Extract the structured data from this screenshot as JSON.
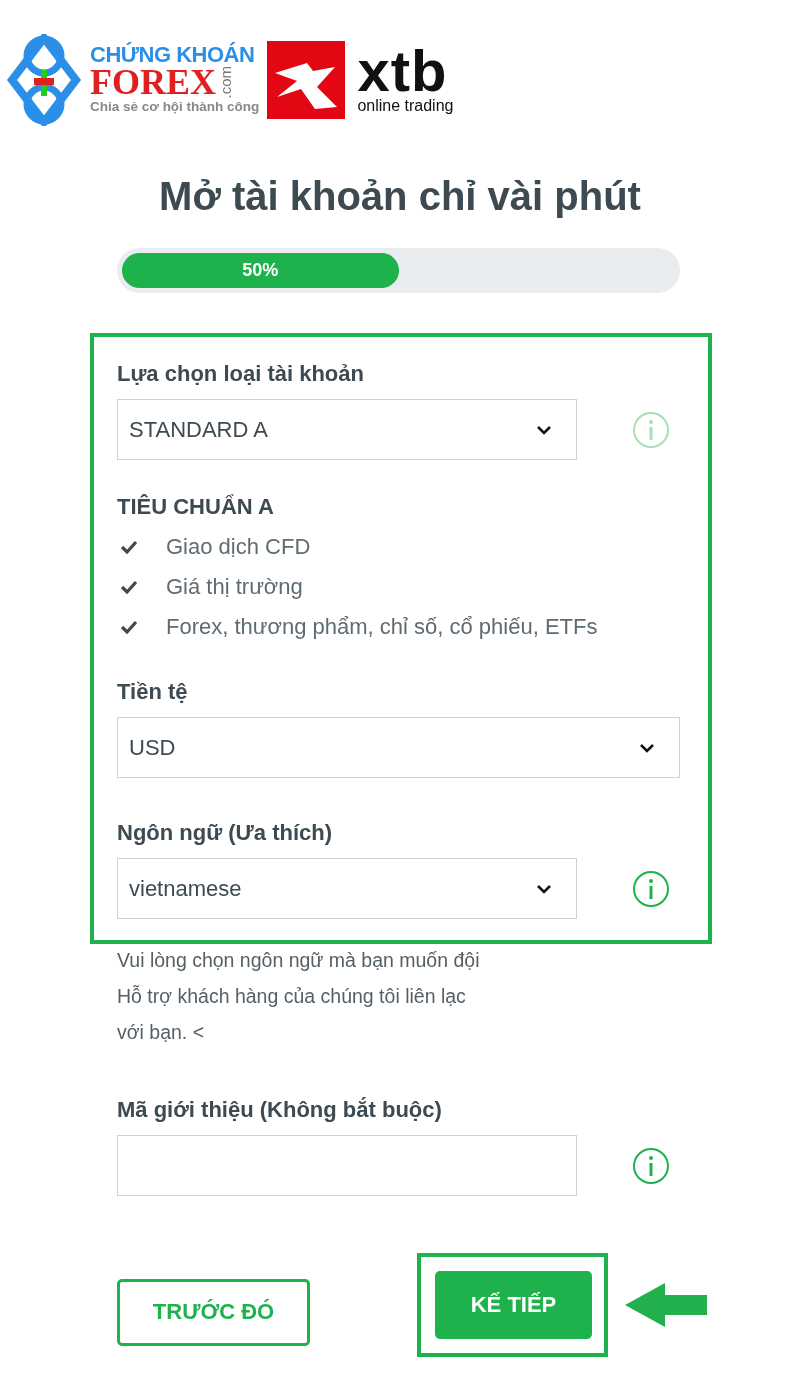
{
  "logos": {
    "partner": {
      "line1": "CHỨNG KHOÁN",
      "line2": "FOREX",
      "domain": ".com",
      "tagline": "Chia sẻ cơ hội thành công"
    },
    "broker": {
      "name": "xtb",
      "tagline": "online trading"
    }
  },
  "title": "Mở tài khoản chỉ vài phút",
  "progress": {
    "level": 0.5,
    "label": "50%"
  },
  "form": [
    {
      "kind": "select",
      "label": "Lựa chọn loại tài khoản",
      "value": "STANDARD A",
      "info_icon": true,
      "faded": true,
      "highlighted": true
    },
    {
      "kind": "features",
      "title": "TIÊU CHUẨN A",
      "items": [
        "Giao dịch CFD",
        "Giá thị trường",
        "Forex, thương phẩm, chỉ số, cổ phiếu, ETFs"
      ],
      "highlighted": true
    },
    {
      "kind": "select",
      "label": "Tiền tệ",
      "value": "USD",
      "highlighted": true
    },
    {
      "kind": "select",
      "label": "Ngôn ngữ (Ưa thích)",
      "value": "vietnamese",
      "info_icon": true,
      "faded": false,
      "highlighted": true
    },
    {
      "kind": "help",
      "text": "Vui lòng chọn ngôn ngữ mà bạn muốn đội\nHỗ trợ khách hàng của chúng tôi liên lạc\nvới bạn. <",
      "highlighted": false
    },
    {
      "kind": "text",
      "label": "Mã giới thiệu (Không bắt buộc)",
      "info_icon": true,
      "faded": false,
      "highlighted": false
    }
  ],
  "buttons": [
    {
      "label": "TRƯỚC ĐÓ",
      "kind": "secondary",
      "highlighted": false,
      "pointer": false
    },
    {
      "label": "KẾ TIẾP",
      "kind": "primary",
      "highlighted": true,
      "pointer": true
    }
  ]
}
